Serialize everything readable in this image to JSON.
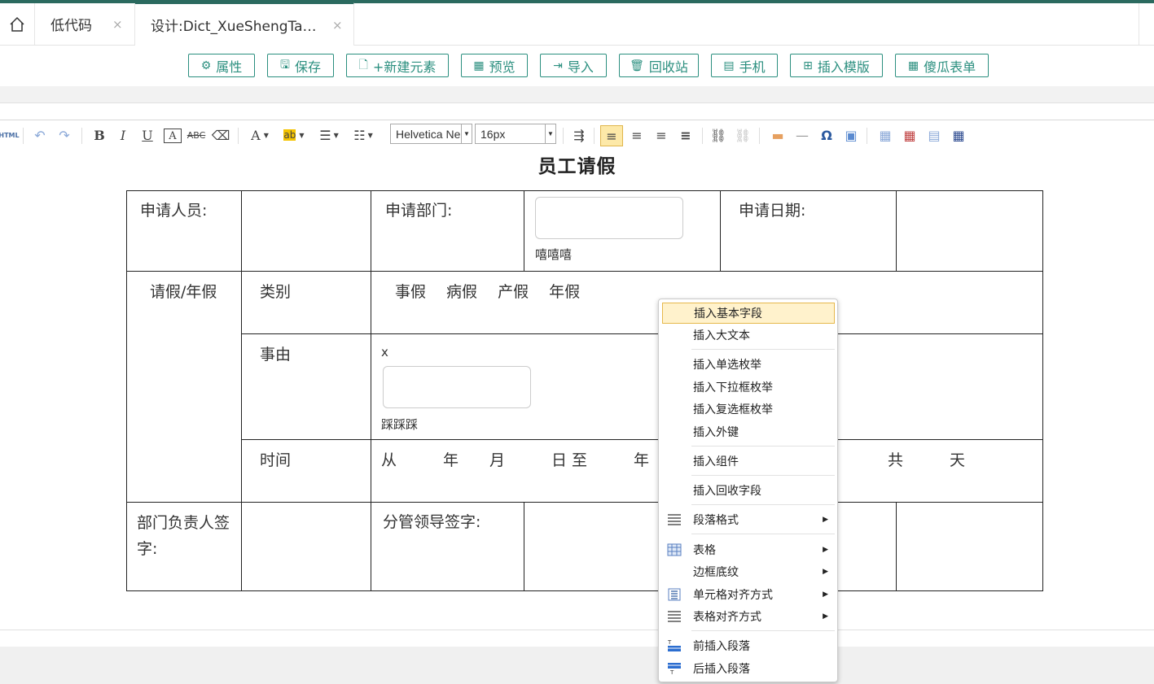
{
  "tabs": [
    {
      "label": "低代码",
      "close": "×"
    },
    {
      "label": "设计:Dict_XueShengTa…",
      "close": "×"
    }
  ],
  "toolbar": {
    "buttons": [
      {
        "label": "属性",
        "icon": "gear-icon",
        "glyph": "⚙"
      },
      {
        "label": "保存",
        "icon": "save-icon",
        "glyph": "🖫"
      },
      {
        "label": "+新建元素",
        "icon": "new-file-icon",
        "glyph": "🗋"
      },
      {
        "label": "预览",
        "icon": "preview-icon",
        "glyph": "▦"
      },
      {
        "label": "导入",
        "icon": "import-icon",
        "glyph": "⇥"
      },
      {
        "label": "回收站",
        "icon": "trash-icon",
        "glyph": "🗑"
      },
      {
        "label": "手机",
        "icon": "mobile-icon",
        "glyph": "▤"
      },
      {
        "label": "插入模版",
        "icon": "template-icon",
        "glyph": "⊞"
      },
      {
        "label": "傻瓜表单",
        "icon": "table-icon",
        "glyph": "▦"
      }
    ]
  },
  "editor": {
    "html_label": "HTML",
    "font_family": "Helvetica Ne",
    "font_size": "16px"
  },
  "form": {
    "title": "员工请假",
    "applicant_label": "申请人员:",
    "dept_label": "申请部门:",
    "dept_hint": "嘻嘻嘻",
    "date_label": "申请日期:",
    "leave_label": "请假/年假",
    "category_label": "类别",
    "category_options": "事假　 病假　 产假　 年假",
    "reason_label": "事由",
    "reason_x": "x",
    "reason_hint": "踩踩踩",
    "time_label": "时间",
    "time_text": "从　　　年　　月　　　日 至　　　年",
    "time_total": "共　　　天",
    "dept_head_label": "部门负责人签字:",
    "leader_label": "分管领导签字:"
  },
  "context_menu": {
    "items": [
      {
        "label": "插入基本字段",
        "highlighted": true
      },
      {
        "label": "插入大文本"
      },
      {
        "label": "插入单选枚举"
      },
      {
        "label": "插入下拉框枚举"
      },
      {
        "label": "插入复选框枚举"
      },
      {
        "label": "插入外键"
      },
      {
        "label": "插入组件"
      },
      {
        "label": "插入回收字段"
      },
      {
        "label": "段落格式",
        "submenu": true,
        "icon": "paragraph-icon"
      },
      {
        "label": "表格",
        "submenu": true,
        "icon": "table-icon"
      },
      {
        "label": "边框底纹",
        "submenu": true
      },
      {
        "label": "单元格对齐方式",
        "submenu": true,
        "icon": "cell-align-icon"
      },
      {
        "label": "表格对齐方式",
        "submenu": true,
        "icon": "table-align-icon"
      },
      {
        "label": "前插入段落",
        "icon": "insert-paragraph-before-icon"
      },
      {
        "label": "后插入段落",
        "icon": "insert-paragraph-after-icon"
      }
    ]
  },
  "colors": {
    "accent": "#2b8f7f",
    "topline": "#2b6a5f",
    "menu_highlight": "#fff2cc"
  }
}
